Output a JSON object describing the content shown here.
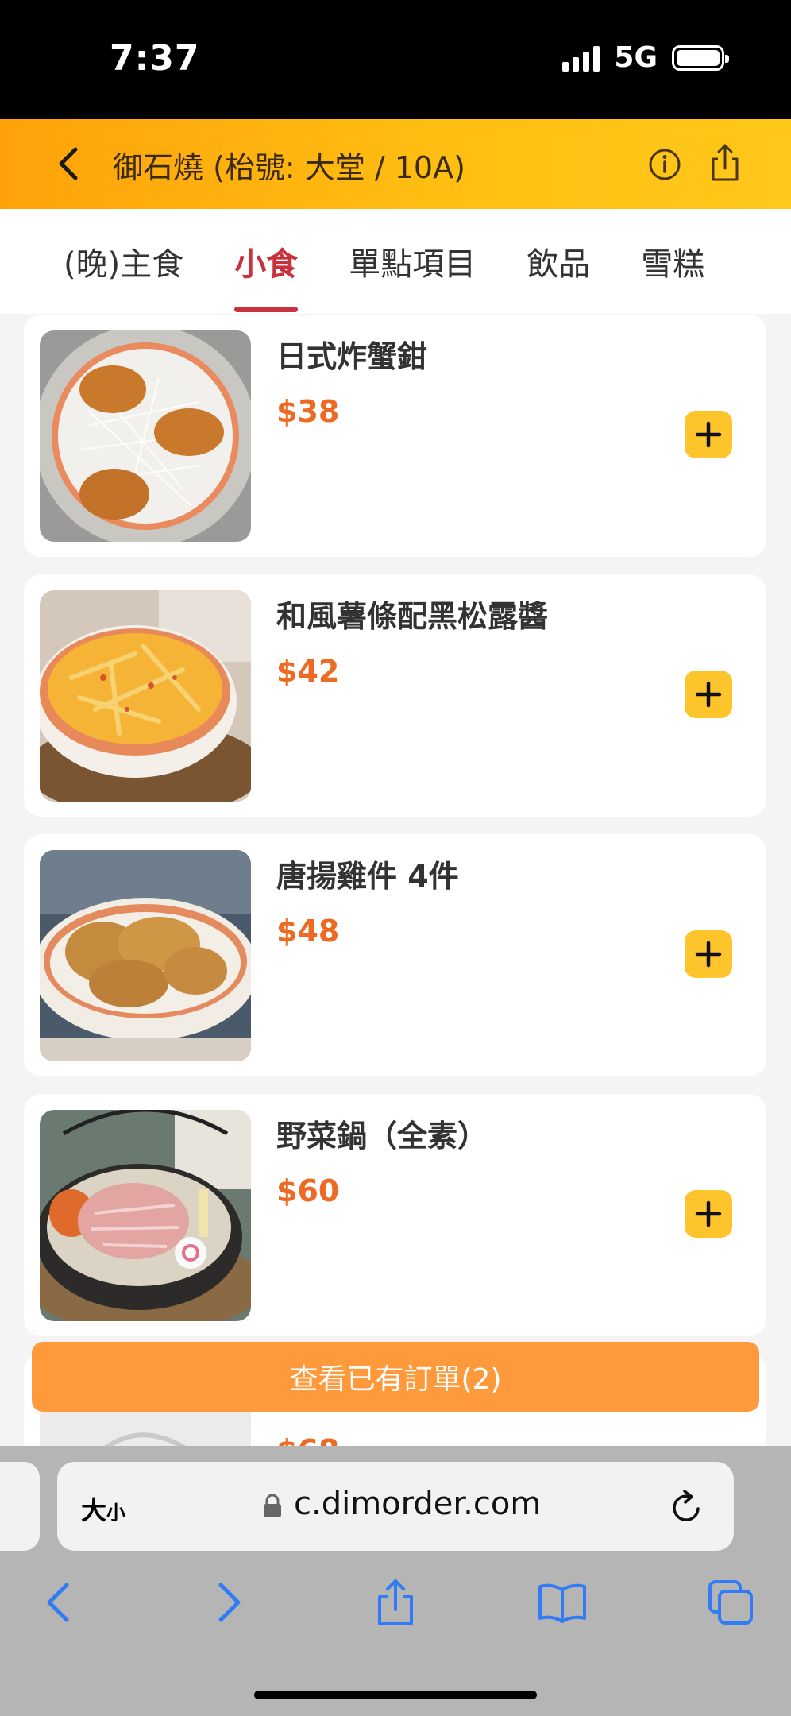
{
  "status_bar": {
    "time": "7:37",
    "network": "5G"
  },
  "header": {
    "title": "御石燒 (枱號: 大堂 / 10A)"
  },
  "tabs": [
    {
      "label": "(晚)主食",
      "active": false
    },
    {
      "label": "小食",
      "active": true
    },
    {
      "label": "單點項目",
      "active": false
    },
    {
      "label": "飲品",
      "active": false
    },
    {
      "label": "雪糕",
      "active": false
    }
  ],
  "items": [
    {
      "name": "日式炸蟹鉗",
      "price": "$38"
    },
    {
      "name": "和風薯條配黑松露醬",
      "price": "$42"
    },
    {
      "name": "唐揚雞件 4件",
      "price": "$48"
    },
    {
      "name": "野菜鍋（全素）",
      "price": "$60"
    },
    {
      "name": "",
      "price": "$68"
    }
  ],
  "order_bar": {
    "label": "查看已有訂單(2)"
  },
  "browser": {
    "text_size_label": "大",
    "text_size_small": "小",
    "url": "c.dimorder.com"
  },
  "colors": {
    "accent": "#ffb00f",
    "active_tab": "#c8323c",
    "price": "#ec6a23",
    "add_button": "#fdc52b",
    "order_bar": "#ff9a3c",
    "browser_icon": "#2f7cf6"
  },
  "icons": [
    "back-icon",
    "info-icon",
    "share-icon",
    "plus-icon",
    "lock-icon",
    "reload-icon",
    "chevron-left-icon",
    "chevron-right-icon",
    "bookmarks-icon",
    "tabs-icon"
  ]
}
